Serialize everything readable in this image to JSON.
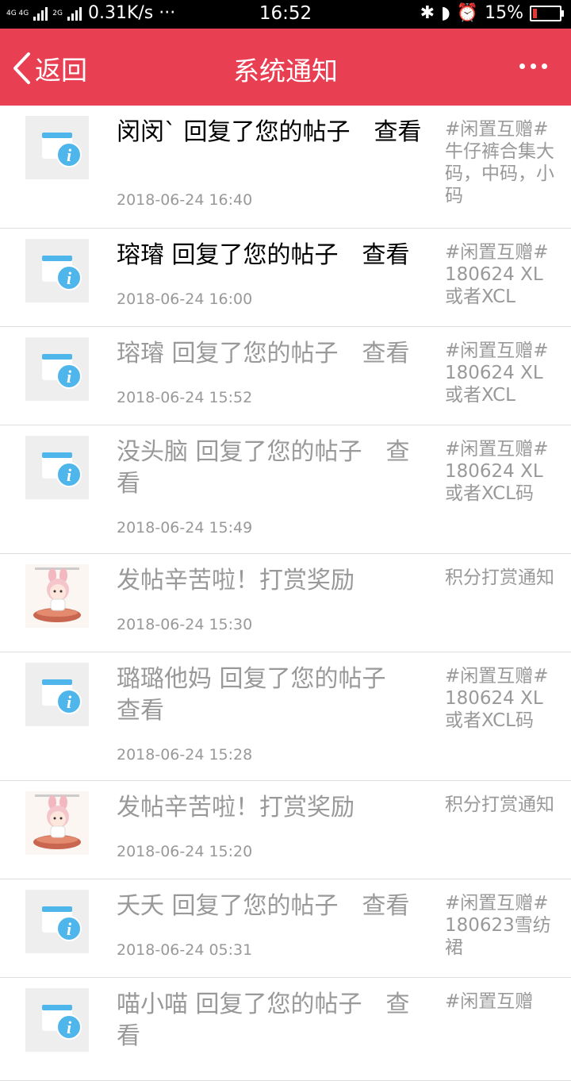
{
  "status_bar": {
    "network": "4G 4G",
    "network2": "2G",
    "speed": "0.31K/s ···",
    "time": "16:52",
    "battery": "15%"
  },
  "nav": {
    "back_label": "返回",
    "title": "系统通知"
  },
  "colors": {
    "accent": "#e84052",
    "info_icon": "#4fb6ec",
    "read_text": "#999999"
  },
  "notifications": [
    {
      "message": "闵闵ˋ 回复了您的帖子　查看",
      "time": "2018-06-24 16:40",
      "topic": "#闲置互赠#牛仔裤合集大码，中码，小码",
      "icon": "info-icon",
      "unread": true
    },
    {
      "message": "瑢璿 回复了您的帖子　查看",
      "time": "2018-06-24 16:00",
      "topic": "#闲置互赠#180624 XL或者XCL",
      "icon": "info-icon",
      "unread": true
    },
    {
      "message": "瑢璿 回复了您的帖子　查看",
      "time": "2018-06-24 15:52",
      "topic": "#闲置互赠#180624 XL或者XCL",
      "icon": "info-icon",
      "unread": false
    },
    {
      "message": "没头脑 回复了您的帖子　查看",
      "time": "2018-06-24 15:49",
      "topic": "#闲置互赠#180624 XL或者XCL码",
      "icon": "info-icon",
      "unread": false
    },
    {
      "message": "发帖辛苦啦！打赏奖励",
      "time": "2018-06-24 15:30",
      "topic": "积分打赏通知",
      "icon": "cartoon-avatar",
      "unread": false
    },
    {
      "message": "璐璐他妈 回复了您的帖子　查看",
      "time": "2018-06-24 15:28",
      "topic": "#闲置互赠#180624 XL或者XCL码",
      "icon": "info-icon",
      "unread": false
    },
    {
      "message": "发帖辛苦啦！打赏奖励",
      "time": "2018-06-24 15:20",
      "topic": "积分打赏通知",
      "icon": "cartoon-avatar",
      "unread": false
    },
    {
      "message": "夭夭 回复了您的帖子　查看",
      "time": "2018-06-24 05:31",
      "topic": "#闲置互赠#180623雪纺裙",
      "icon": "info-icon",
      "unread": false
    },
    {
      "message": "喵小喵 回复了您的帖子　查看",
      "time": "",
      "topic": "#闲置互赠",
      "icon": "info-icon",
      "unread": false
    }
  ]
}
